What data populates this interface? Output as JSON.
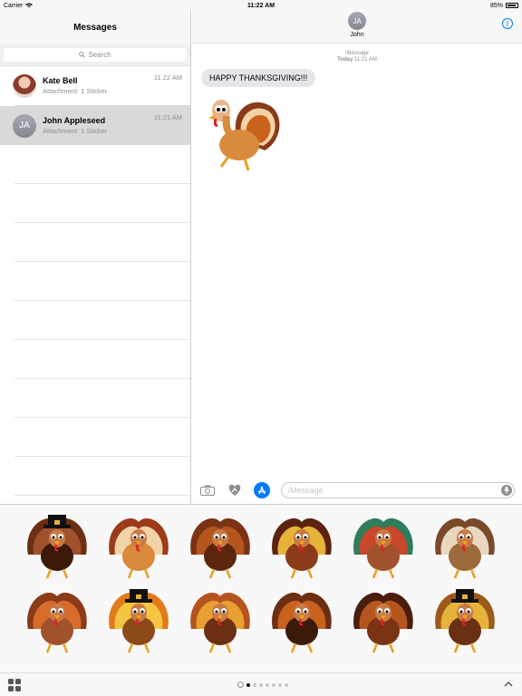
{
  "status_bar": {
    "carrier": "Carrier",
    "time": "11:22 AM",
    "battery": "85%"
  },
  "sidebar": {
    "title": "Messages",
    "search_placeholder": "Search",
    "conversations": [
      {
        "name": "Kate Bell",
        "preview": "Attachment: 1 Sticker",
        "time": "11:22 AM",
        "avatar": "photo"
      },
      {
        "name": "John Appleseed",
        "preview": "Attachment: 1 Sticker",
        "time": "11:21 AM",
        "avatar": "JA",
        "selected": true
      }
    ]
  },
  "conversation": {
    "contact_initials": "JA",
    "contact_name": "John",
    "service": "iMessage",
    "day": "Today",
    "timestamp": "11:21 AM",
    "message": "HAPPY THANKSGIVING!!!",
    "sticker_icon": "turkey-sticker"
  },
  "composer": {
    "placeholder": "iMessage"
  },
  "stickers": [
    "pilgrim-turkey-1",
    "turkey-2",
    "turkey-3",
    "turkey-4",
    "turkey-5",
    "turkey-6",
    "turkey-7",
    "pilgrim-turkey-8",
    "turkey-9",
    "turkey-10",
    "turkey-11",
    "pilgrim-turkey-12"
  ],
  "colors": {
    "accent": "#007aff",
    "bubble": "#e5e5ea",
    "selected_row": "#d9d9d9"
  }
}
